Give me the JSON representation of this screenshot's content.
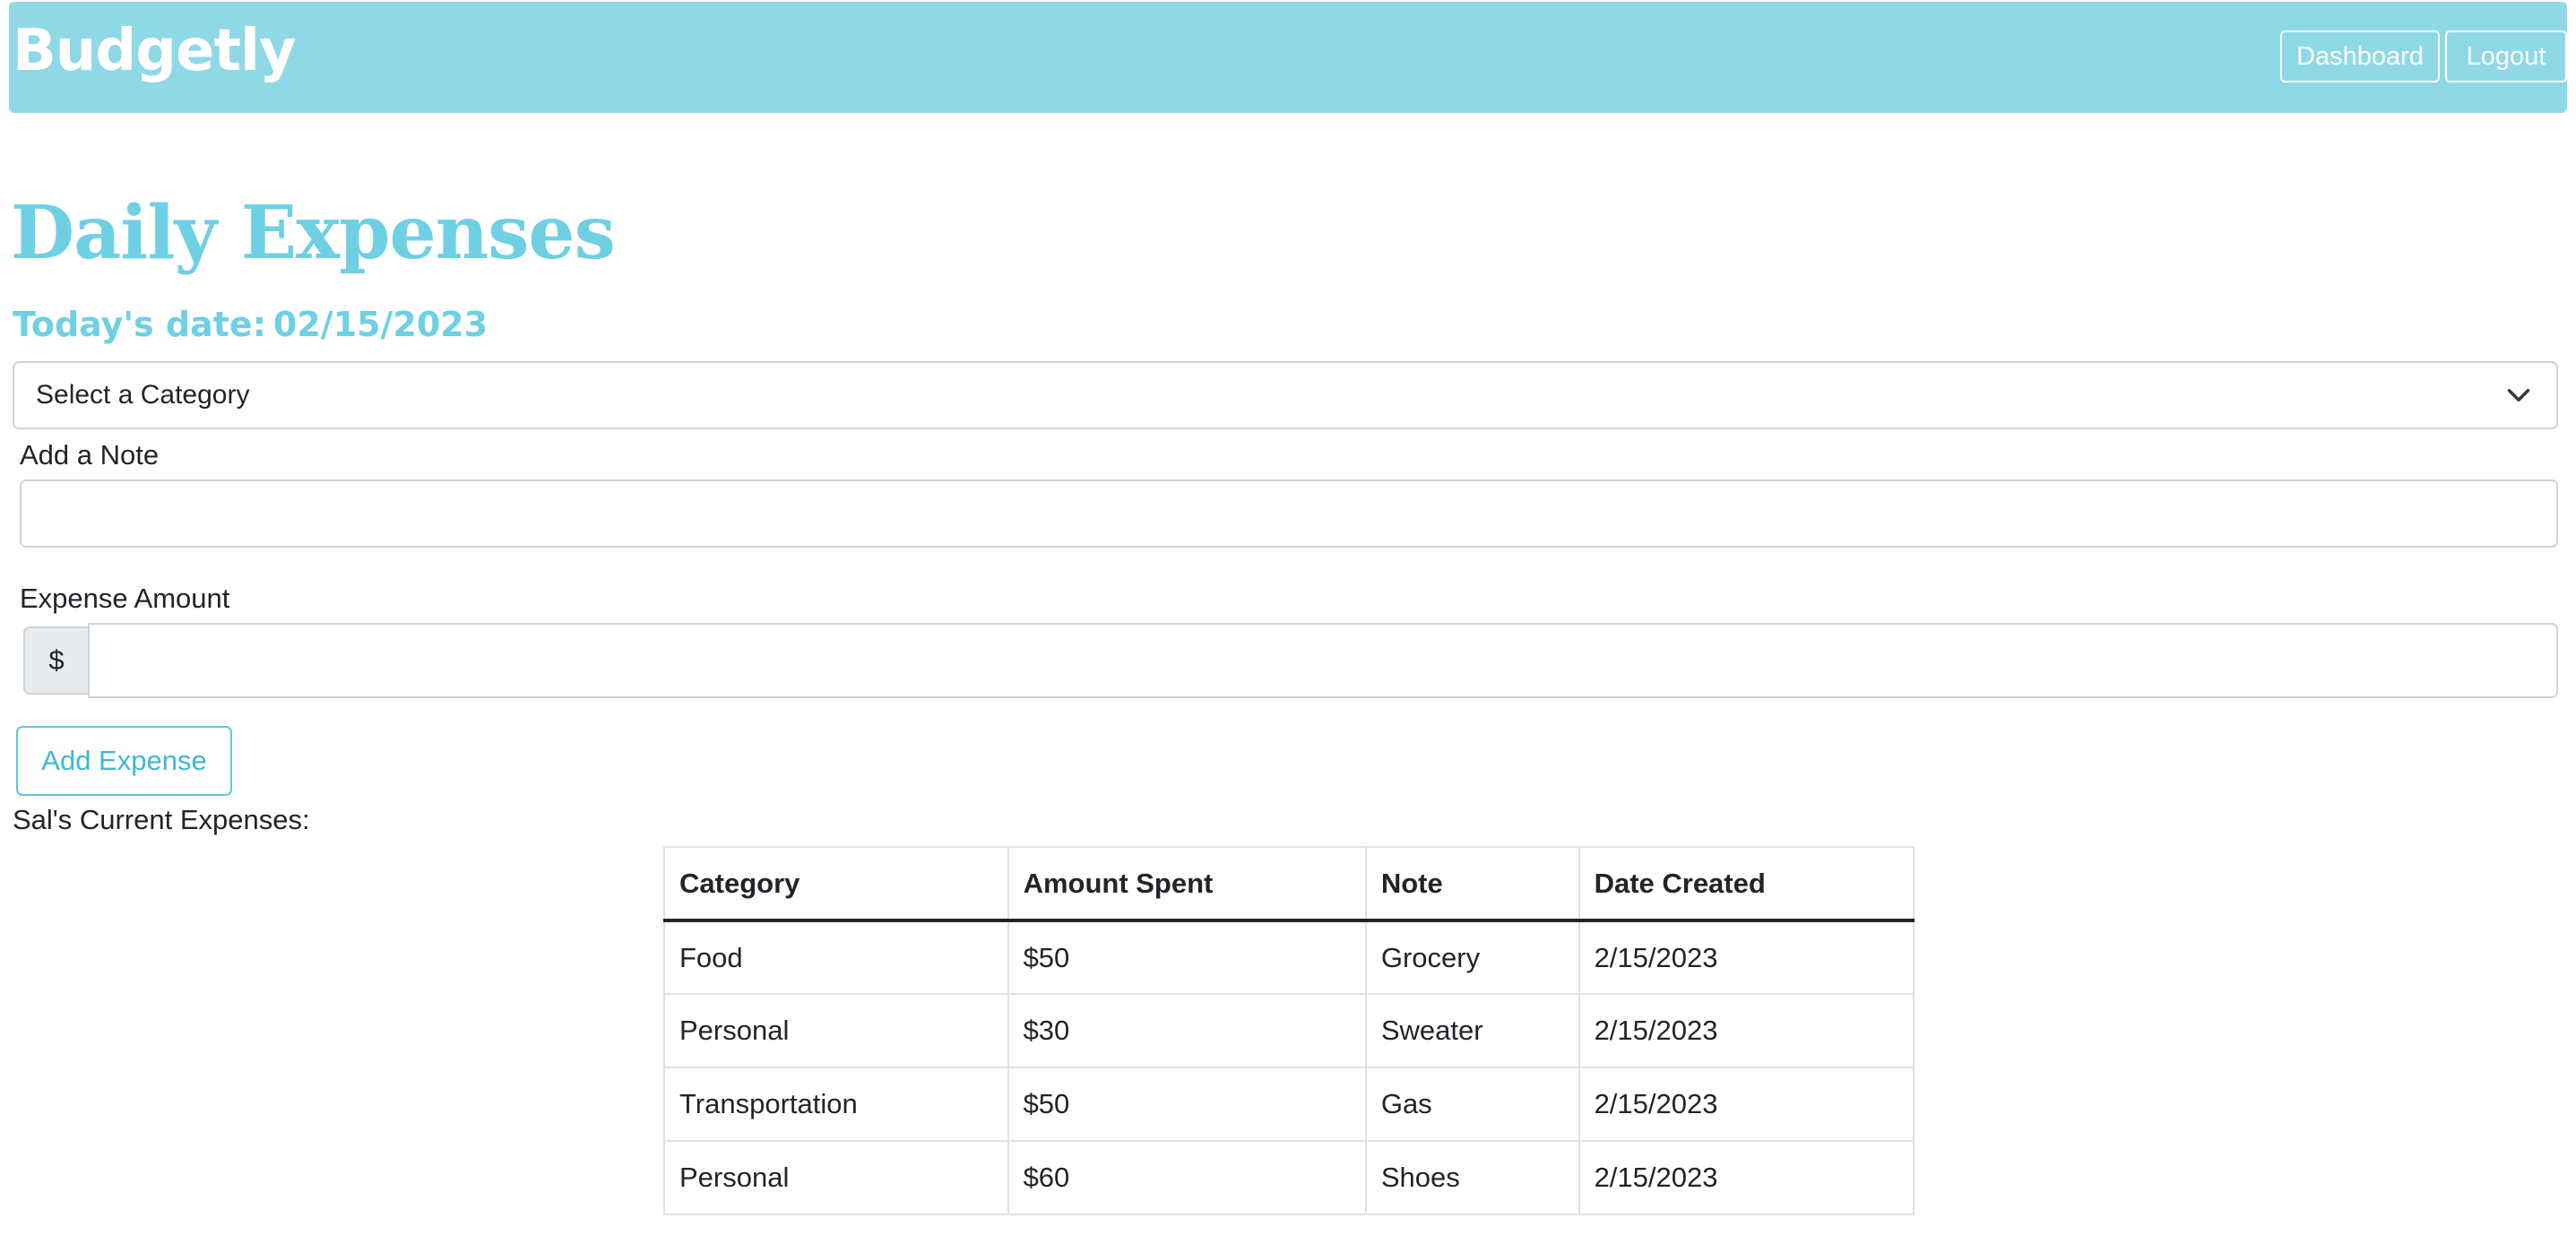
{
  "navbar": {
    "brand": "Budgetly",
    "dashboard_label": "Dashboard",
    "logout_label": "Logout",
    "bg_color": "#8fd9e6"
  },
  "page": {
    "title": "Daily Expenses",
    "date_label": "Today's date:",
    "date_value": "02/15/2023",
    "accent_color": "#6fd0e3"
  },
  "form": {
    "category_select": {
      "selected": "Select a Category",
      "icon": "chevron-down-icon"
    },
    "note_label": "Add a Note",
    "note_value": "",
    "amount_label": "Expense Amount",
    "amount_prefix": "$",
    "amount_value": "",
    "add_button_label": "Add Expense"
  },
  "expenses": {
    "caption": "Sal's Current Expenses:",
    "columns": [
      "Category",
      "Amount Spent",
      "Note",
      "Date Created"
    ],
    "rows": [
      {
        "category": "Food",
        "amount": "$50",
        "note": "Grocery",
        "date": "2/15/2023"
      },
      {
        "category": "Personal",
        "amount": "$30",
        "note": "Sweater",
        "date": "2/15/2023"
      },
      {
        "category": "Transportation",
        "amount": "$50",
        "note": "Gas",
        "date": "2/15/2023"
      },
      {
        "category": "Personal",
        "amount": "$60",
        "note": "Shoes",
        "date": "2/15/2023"
      }
    ]
  }
}
